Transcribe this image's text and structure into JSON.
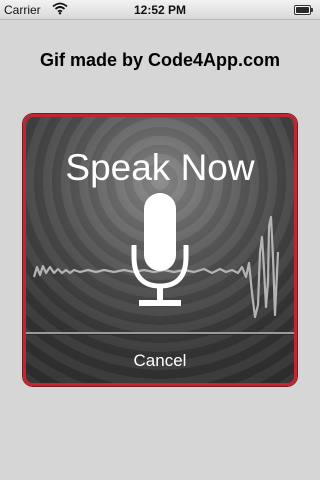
{
  "status_bar": {
    "carrier": "Carrier",
    "time": "12:52 PM",
    "wifi_icon": "wifi-icon",
    "battery_icon": "battery-icon"
  },
  "app_title": "Gif made by Code4App.com",
  "speak_panel": {
    "title": "Speak Now",
    "cancel_label": "Cancel",
    "mic_icon": "microphone-icon",
    "border_color": "#c0262f",
    "waveform_color": "#b3b3b3"
  }
}
